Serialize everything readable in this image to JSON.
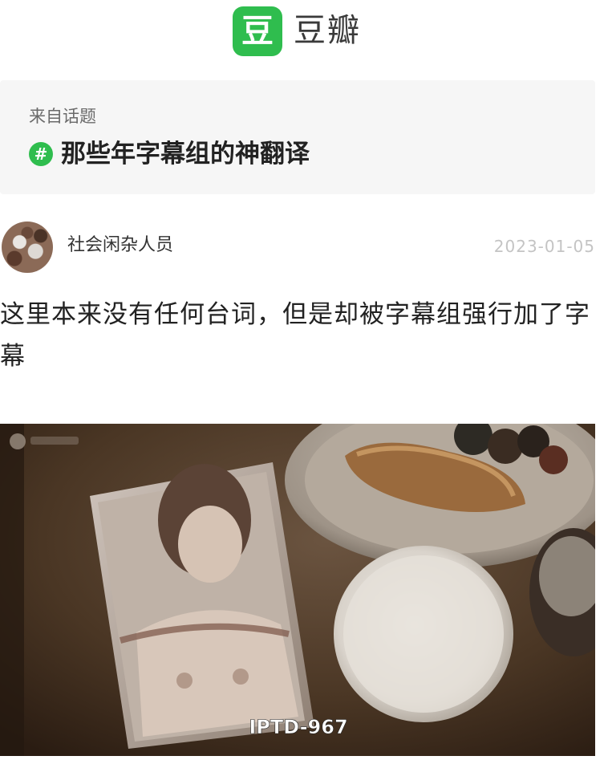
{
  "app": {
    "logo_glyph": "豆",
    "name": "豆瓣",
    "brand_color": "#2fbd4e"
  },
  "topic": {
    "from_label": "来自话题",
    "hash_icon": "#",
    "title": "那些年字幕组的神翻译"
  },
  "post": {
    "author": "社会闲杂人员",
    "date": "2023-01-05",
    "text": "这里本来没有任何台词，但是却被字幕组强行加了字幕",
    "image": {
      "subtitle": "IPTD-967",
      "description_icon": "photo-icon"
    }
  }
}
